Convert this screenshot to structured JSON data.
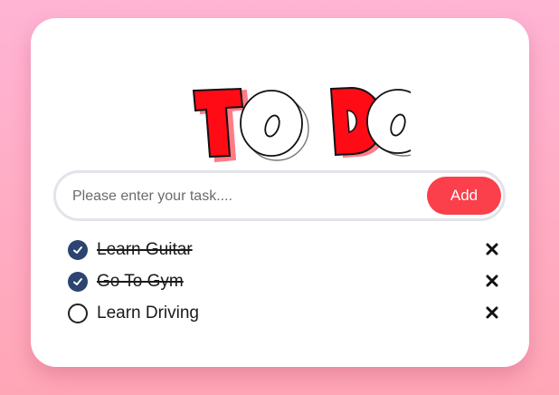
{
  "app": {
    "logo_text": "TODO"
  },
  "input": {
    "placeholder": "Please enter your task....",
    "value": "",
    "add_label": "Add"
  },
  "tasks": [
    {
      "label": "Learn Guitar",
      "completed": true
    },
    {
      "label": "Go To Gym",
      "completed": true
    },
    {
      "label": "Learn Driving",
      "completed": false
    }
  ],
  "colors": {
    "accent": "#fb3f4b",
    "check": "#2b4470",
    "background_top": "#ffb4d4",
    "background_bottom": "#ffa6b6"
  }
}
